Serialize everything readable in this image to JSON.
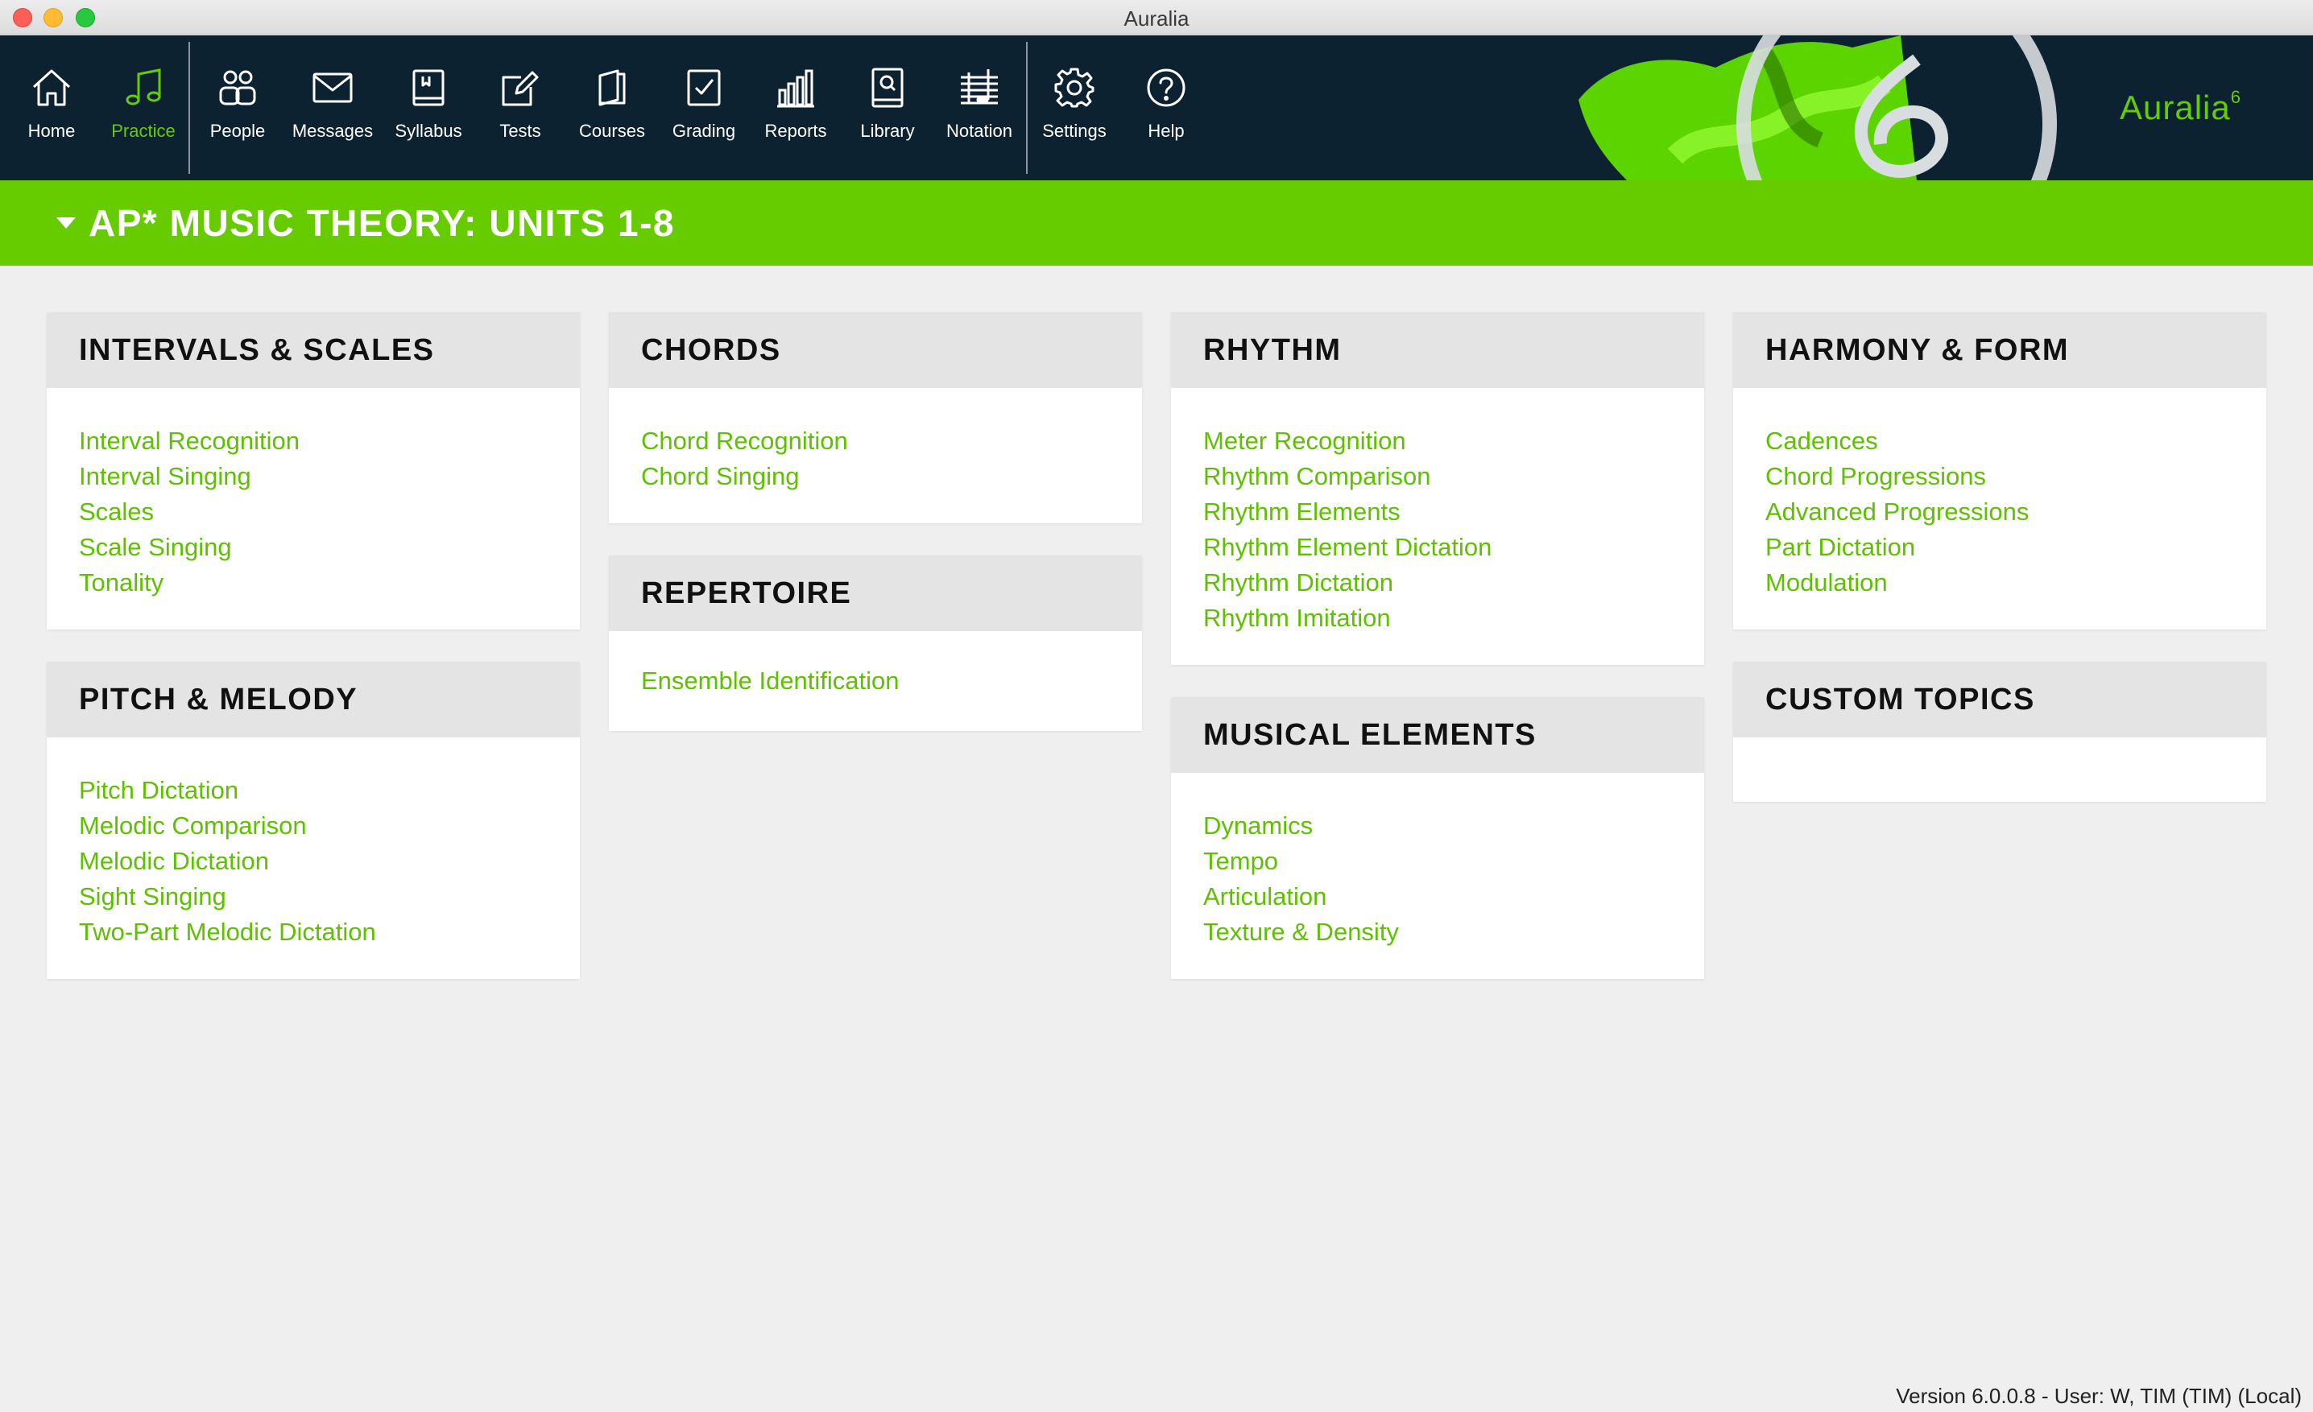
{
  "window": {
    "title": "Auralia"
  },
  "toolbar": {
    "items": [
      {
        "label": "Home",
        "icon": "home-icon"
      },
      {
        "label": "Practice",
        "icon": "music-note-icon",
        "active": true
      },
      {
        "label": "People",
        "icon": "people-icon"
      },
      {
        "label": "Messages",
        "icon": "envelope-icon"
      },
      {
        "label": "Syllabus",
        "icon": "syllabus-book-icon"
      },
      {
        "label": "Tests",
        "icon": "edit-pencil-icon"
      },
      {
        "label": "Courses",
        "icon": "courses-book-icon"
      },
      {
        "label": "Grading",
        "icon": "checkbox-icon"
      },
      {
        "label": "Reports",
        "icon": "bar-chart-icon"
      },
      {
        "label": "Library",
        "icon": "library-search-icon"
      },
      {
        "label": "Notation",
        "icon": "staff-notation-icon"
      },
      {
        "label": "Settings",
        "icon": "gear-icon"
      },
      {
        "label": "Help",
        "icon": "question-icon"
      }
    ],
    "brand": {
      "name": "Auralia",
      "version_mark": "6"
    }
  },
  "course": {
    "title": "AP* MUSIC THEORY: UNITS 1-8"
  },
  "cards": {
    "intervals": {
      "title": "INTERVALS & SCALES",
      "items": [
        "Interval Recognition",
        "Interval Singing",
        "Scales",
        "Scale Singing",
        "Tonality"
      ]
    },
    "pitch": {
      "title": "PITCH & MELODY",
      "items": [
        "Pitch Dictation",
        "Melodic Comparison",
        "Melodic Dictation",
        "Sight Singing",
        "Two-Part Melodic Dictation"
      ]
    },
    "chords": {
      "title": "CHORDS",
      "items": [
        "Chord Recognition",
        "Chord Singing"
      ]
    },
    "repertoire": {
      "title": "REPERTOIRE",
      "items": [
        "Ensemble Identification"
      ]
    },
    "rhythm": {
      "title": "RHYTHM",
      "items": [
        "Meter Recognition",
        "Rhythm Comparison",
        "Rhythm Elements",
        "Rhythm Element Dictation",
        "Rhythm Dictation",
        "Rhythm Imitation"
      ]
    },
    "musical": {
      "title": "MUSICAL ELEMENTS",
      "items": [
        "Dynamics",
        "Tempo",
        "Articulation",
        "Texture & Density"
      ]
    },
    "harmony": {
      "title": "HARMONY & FORM",
      "items": [
        "Cadences",
        "Chord Progressions",
        "Advanced Progressions",
        "Part Dictation",
        "Modulation"
      ]
    },
    "custom": {
      "title": "CUSTOM TOPICS",
      "items": []
    }
  },
  "footer": {
    "status": "Version 6.0.0.8 - User: W, TIM (TIM) (Local)"
  },
  "colors": {
    "accent": "#66cc00",
    "toolbar_bg": "#0d2230",
    "page_bg": "#efefef",
    "card_header_bg": "#e4e4e4"
  }
}
